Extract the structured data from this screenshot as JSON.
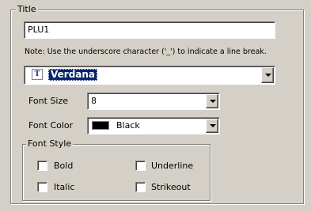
{
  "title_group": {
    "legend": "Title",
    "title_value": "PLU1",
    "note": "Note: Use the underscore character ('_') to indicate a line break."
  },
  "font": {
    "icon": "truetype-font-icon",
    "selected": "Verdana"
  },
  "font_size": {
    "label": "Font Size",
    "value": "8"
  },
  "font_color": {
    "label": "Font Color",
    "value": "Black",
    "swatch_color": "#000000"
  },
  "font_style": {
    "legend": "Font Style",
    "options": [
      {
        "label": "Bold",
        "checked": false
      },
      {
        "label": "Underline",
        "checked": false
      },
      {
        "label": "Italic",
        "checked": false
      },
      {
        "label": "Strikeout",
        "checked": false
      }
    ]
  },
  "colors": {
    "face": "#d4d0c8",
    "selection": "#0a246a"
  }
}
